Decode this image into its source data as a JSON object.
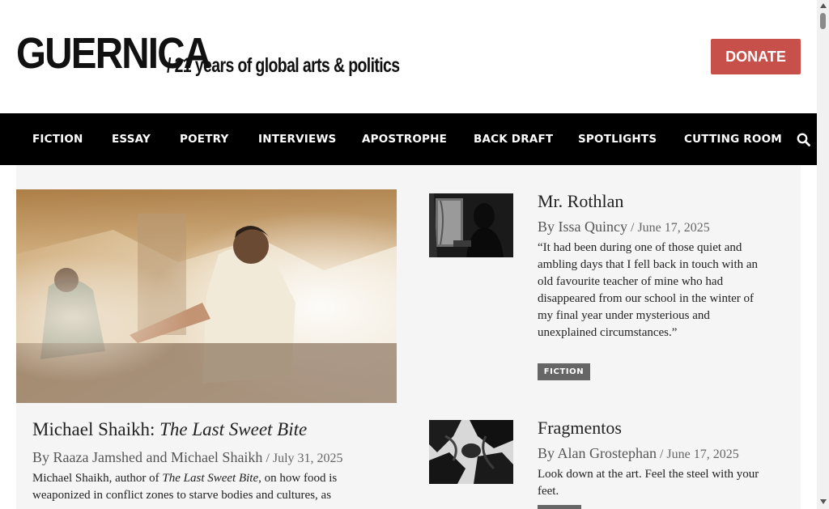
{
  "header": {
    "logo": "GUERNICA",
    "tagline": "/ 21 years of global arts & politics",
    "donate_label": "DONATE"
  },
  "nav": {
    "items": [
      "FICTION",
      "ESSAY",
      "POETRY",
      "INTERVIEWS",
      "APOSTROPHE",
      "BACK DRAFT",
      "SPOTLIGHTS",
      "CUTTING ROOM"
    ],
    "search_icon": "search-icon"
  },
  "featured": {
    "title_prefix": "Michael Shaikh: ",
    "title_italic": "The Last Sweet Bite",
    "by": "By ",
    "authors": "Raaza Jamshed and Michael Shaikh",
    "date": " / July 31, 2025",
    "excerpt_1": "Michael Shaikh, author of ",
    "excerpt_italic": "The Last Sweet Bite",
    "excerpt_2": ", on how food is weaponized in conflict zones to starve bodies and cultures, as"
  },
  "articles": [
    {
      "title": "Mr. Rothlan",
      "by": "By ",
      "author": "Issa Quincy",
      "date": " / June 17, 2025",
      "excerpt": "“It had been during one of those quiet and ambling days that I fell back in touch with an old favourite teacher of mine who had disappeared from our school in the winter of my final year under mysterious and unexplained circumstances.”",
      "tag": "FICTION"
    },
    {
      "title": "Fragmentos",
      "by": "By ",
      "author": "Alan Grostephan",
      "date": " / June 17, 2025",
      "excerpt": "Look down at the art. Feel the steel with your feet.",
      "tag": ""
    }
  ],
  "colors": {
    "donate": "#c8504a",
    "nav_bg": "#000000",
    "tag_bg": "#666666"
  }
}
